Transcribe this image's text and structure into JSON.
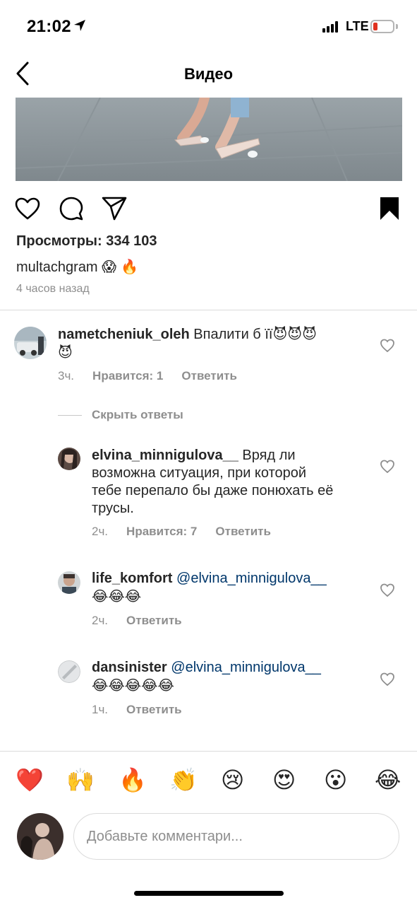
{
  "status": {
    "time": "21:02",
    "network": "LTE",
    "battery_color": "#e0311f"
  },
  "nav": {
    "title": "Видео",
    "back_icon": "chevron-left-icon"
  },
  "post": {
    "views": "Просмотры: 334 103",
    "caption_user": "multachgram",
    "caption_emoji": "😱 🔥",
    "time_ago": "4 часов назад"
  },
  "comments": [
    {
      "username": "nametcheniuk_oleh",
      "text": "Впалити б її",
      "emoji_line1": "😈😈😈",
      "emoji_line2": "😈",
      "time": "3ч.",
      "likes": "Нравится: 1",
      "reply": "Ответить"
    }
  ],
  "hide_replies": "Скрыть ответы",
  "replies": [
    {
      "username": "elvina_minnigulova__",
      "line1": "Вряд ли",
      "line2": "возможна ситуация, при которой",
      "line3": "тебе перепало бы даже понюхать её",
      "line4": "трусы.",
      "time": "2ч.",
      "likes": "Нравится: 7",
      "reply": "Ответить"
    },
    {
      "username": "life_komfort",
      "mention": "@elvina_minnigulova__",
      "emoji": "😂😂😂",
      "time": "2ч.",
      "reply": "Ответить"
    },
    {
      "username": "dansinister",
      "mention": "@elvina_minnigulova__",
      "emoji": "😂😂😂😂😂",
      "time": "1ч.",
      "reply": "Ответить"
    }
  ],
  "quick_emojis": [
    "❤️",
    "🙌",
    "🔥",
    "👏",
    "😢",
    "😍",
    "😮",
    "😂"
  ],
  "composer": {
    "placeholder": "Добавьте комментари..."
  }
}
